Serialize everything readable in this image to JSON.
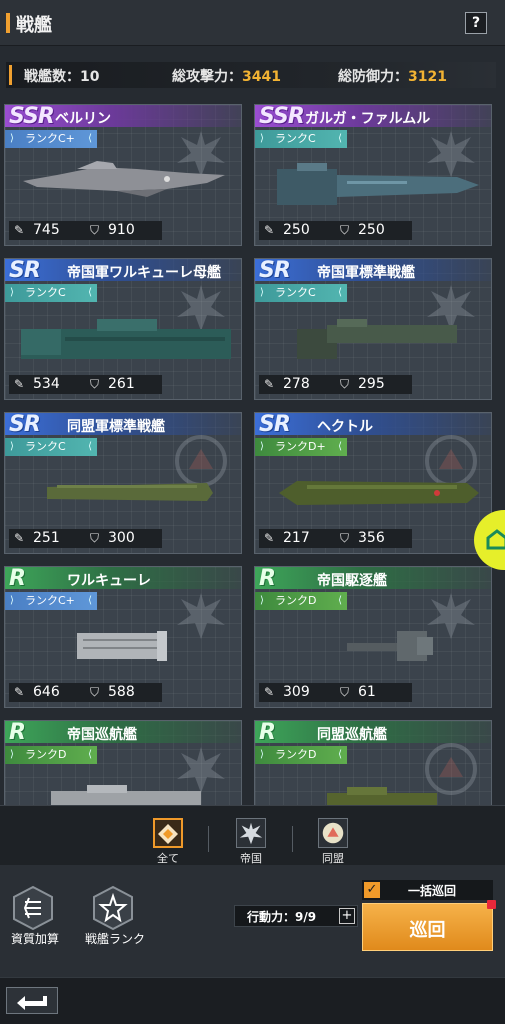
{
  "header": {
    "title": "戦艦",
    "help_label": "?"
  },
  "stats": {
    "count_label": "戦艦数：",
    "count_value": "10",
    "attack_label": "総攻撃力：",
    "attack_value": "3441",
    "defense_label": "総防御力：",
    "defense_value": "3121"
  },
  "ships": [
    {
      "rarity": "SSR",
      "name": "ベルリン",
      "rank": "ランクC+",
      "attack": "745",
      "defense": "910"
    },
    {
      "rarity": "SSR",
      "name": "ガルガ・ファルムル",
      "rank": "ランクC",
      "attack": "250",
      "defense": "250"
    },
    {
      "rarity": "SR",
      "name": "帝国軍ワルキューレ母艦",
      "rank": "ランクC",
      "attack": "534",
      "defense": "261"
    },
    {
      "rarity": "SR",
      "name": "帝国軍標準戦艦",
      "rank": "ランクC",
      "attack": "278",
      "defense": "295"
    },
    {
      "rarity": "SR",
      "name": "同盟軍標準戦艦",
      "rank": "ランクC",
      "attack": "251",
      "defense": "300"
    },
    {
      "rarity": "SR",
      "name": "ヘクトル",
      "rank": "ランクD+",
      "attack": "217",
      "defense": "356"
    },
    {
      "rarity": "R",
      "name": "ワルキューレ",
      "rank": "ランクC+",
      "attack": "646",
      "defense": "588"
    },
    {
      "rarity": "R",
      "name": "帝国駆逐艦",
      "rank": "ランクD",
      "attack": "309",
      "defense": "61"
    },
    {
      "rarity": "R",
      "name": "帝国巡航艦",
      "rank": "ランクD",
      "attack": "",
      "defense": ""
    },
    {
      "rarity": "R",
      "name": "同盟巡航艦",
      "rank": "ランクD",
      "attack": "",
      "defense": ""
    }
  ],
  "filters": {
    "all": "全て",
    "empire": "帝国",
    "alliance": "同盟"
  },
  "bottom": {
    "resource_bonus": "資質加算",
    "ship_rank": "戦艦ランク",
    "action_label": "行動力：9/9",
    "action_plus": "+",
    "bulk_patrol": "一括巡回",
    "patrol": "巡回",
    "checkbox_mark": "✓"
  },
  "colors": {
    "accent": "#f09a2a",
    "value_gold": "#f2b333",
    "side_tab": "#e6ef2a"
  }
}
